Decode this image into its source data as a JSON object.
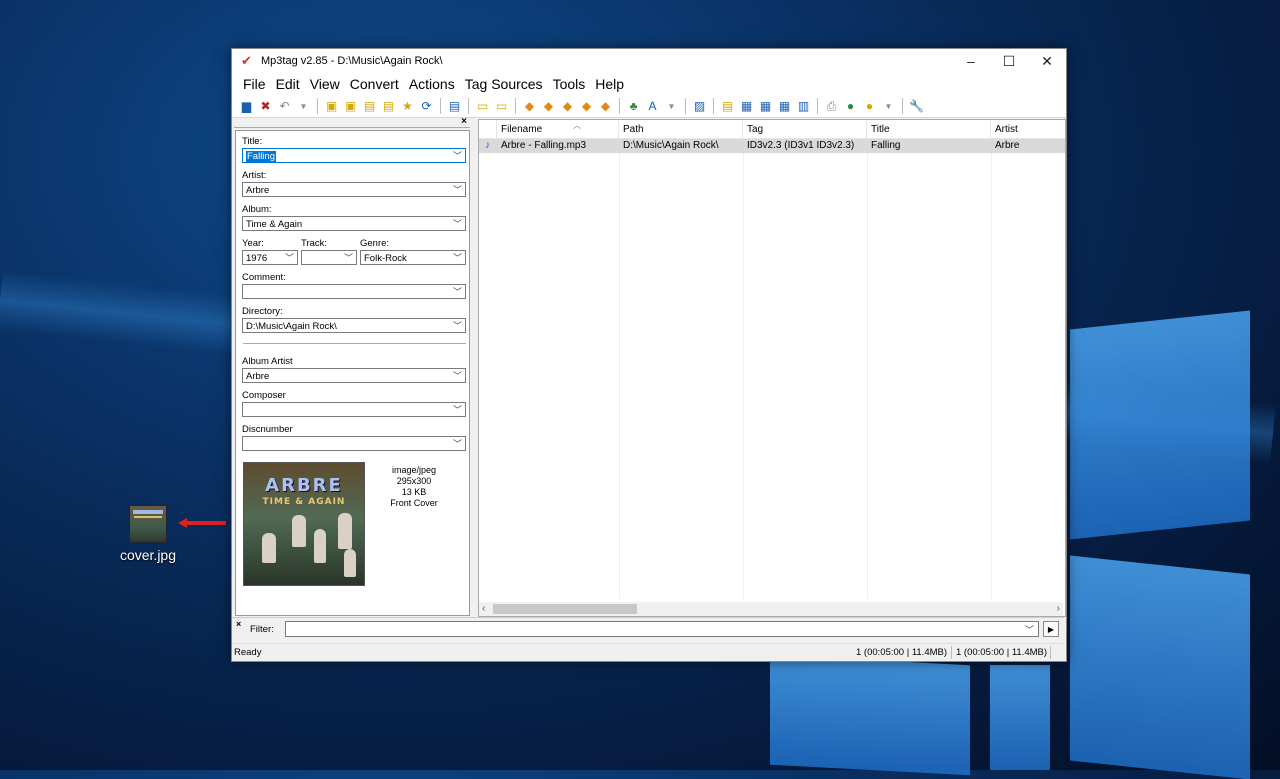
{
  "desktop": {
    "icon_label": "cover.jpg"
  },
  "window": {
    "title": "Mp3tag v2.85  -  D:\\Music\\Again Rock\\",
    "controls": {
      "minimize": "–",
      "maximize": "☐",
      "close": "✕"
    }
  },
  "menu": {
    "items": [
      "File",
      "Edit",
      "View",
      "Convert",
      "Actions",
      "Tag Sources",
      "Tools",
      "Help"
    ]
  },
  "toolbar": {
    "icons": [
      "save-icon",
      "remove-tag-icon",
      "undo-icon",
      "dropdown-icon",
      "change-directory-icon",
      "add-directory-icon",
      "open-folder-icon",
      "playlist-icon",
      "favorites-star-icon",
      "refresh-icon",
      "select-all-icon",
      "tag-filename-icon",
      "filename-tag-icon",
      "text-file-tag-icon",
      "tag-tag-icon",
      "format-value-icon",
      "action-icon",
      "case-conversion-icon",
      "actions-dropdown-icon",
      "autonumbering-icon",
      "export-icon",
      "playlist-create-icon",
      "freedb-icon",
      "discogs-icon",
      "amazon-icon",
      "web-sources-icon",
      "sources-dropdown-icon",
      "options-wrench-icon"
    ]
  },
  "tag_panel": {
    "close": "×",
    "title_label": "Title:",
    "title_value": "Falling",
    "artist_label": "Artist:",
    "artist_value": "Arbre",
    "album_label": "Album:",
    "album_value": "Time & Again",
    "year_label": "Year:",
    "year_value": "1976",
    "track_label": "Track:",
    "track_value": "",
    "genre_label": "Genre:",
    "genre_value": "Folk-Rock",
    "comment_label": "Comment:",
    "comment_value": "",
    "directory_label": "Directory:",
    "directory_value": "D:\\Music\\Again Rock\\",
    "album_artist_label": "Album Artist",
    "album_artist_value": "Arbre",
    "composer_label": "Composer",
    "composer_value": "",
    "discnumber_label": "Discnumber",
    "discnumber_value": "",
    "cover": {
      "art_title": "ARBRE",
      "art_subtitle": "TIME & AGAIN",
      "mime": "image/jpeg",
      "dimensions": "295x300",
      "size": "13 KB",
      "type": "Front Cover"
    }
  },
  "file_list": {
    "columns": [
      "Filename",
      "Path",
      "Tag",
      "Title",
      "Artist"
    ],
    "rows": [
      [
        "Arbre - Falling.mp3",
        "D:\\Music\\Again Rock\\",
        "ID3v2.3 (ID3v1 ID3v2.3)",
        "Falling",
        "Arbre"
      ]
    ]
  },
  "filter": {
    "close": "×",
    "label": "Filter:",
    "value": ""
  },
  "status": {
    "left": "Ready",
    "selected": "1 (00:05:00 | 11.4MB)",
    "total": "1 (00:05:00 | 11.4MB)"
  },
  "colors": {
    "selection": "#0078d7",
    "row_highlight": "#d9d9d9",
    "annotation_arrow": "#e02020"
  }
}
